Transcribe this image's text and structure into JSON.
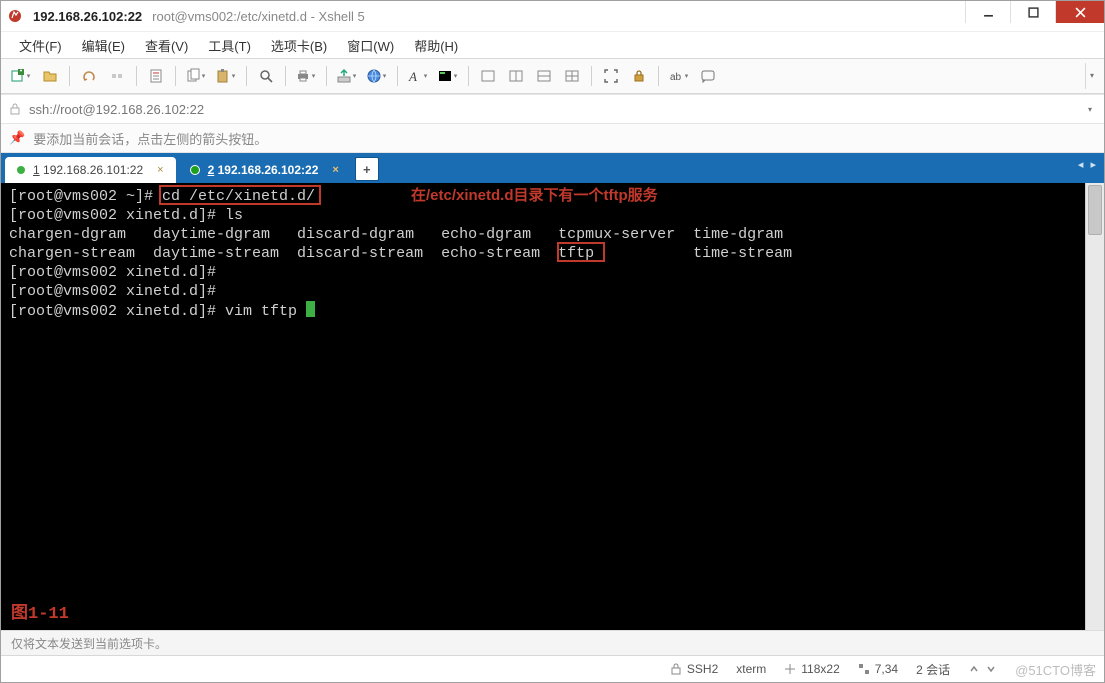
{
  "title": {
    "host": "192.168.26.102:22",
    "rest": "root@vms002:/etc/xinetd.d - Xshell 5"
  },
  "menu": {
    "file": "文件(F)",
    "edit": "编辑(E)",
    "view": "查看(V)",
    "tools": "工具(T)",
    "tabs": "选项卡(B)",
    "window": "窗口(W)",
    "help": "帮助(H)"
  },
  "address": {
    "url": "ssh://root@192.168.26.102:22"
  },
  "hint": {
    "text": "要添加当前会话，点击左侧的箭头按钮。"
  },
  "tabs": {
    "t1": {
      "num": "1",
      "label": "192.168.26.101:22"
    },
    "t2": {
      "num": "2",
      "label": "192.168.26.102:22"
    },
    "add": "+"
  },
  "terminal": {
    "l1a": "[root@vms002 ~]# ",
    "l1b": "cd /etc/xinetd.d/",
    "l2": "[root@vms002 xinetd.d]# ls",
    "l3": "chargen-dgram   daytime-dgram   discard-dgram   echo-dgram   tcpmux-server  time-dgram",
    "l4a": "chargen-stream  daytime-stream  discard-stream  echo-stream  ",
    "l4b": "tftp",
    "l4c": "           time-stream",
    "l5": "[root@vms002 xinetd.d]#",
    "l6": "[root@vms002 xinetd.d]#",
    "l7": "[root@vms002 xinetd.d]# vim tftp ",
    "annotation": "在/etc/xinetd.d目录下有一个tftp服务",
    "fig": "图1-11"
  },
  "bottom_hint": "仅将文本发送到当前选项卡。",
  "status": {
    "ssh": "SSH2",
    "term": "xterm",
    "size": "118x22",
    "pos": "7,34",
    "sessions": "2 会话",
    "watermark": "@51CTO博客"
  },
  "icons": {
    "min": "minimize-icon",
    "max": "maximize-icon",
    "close": "close-icon"
  }
}
